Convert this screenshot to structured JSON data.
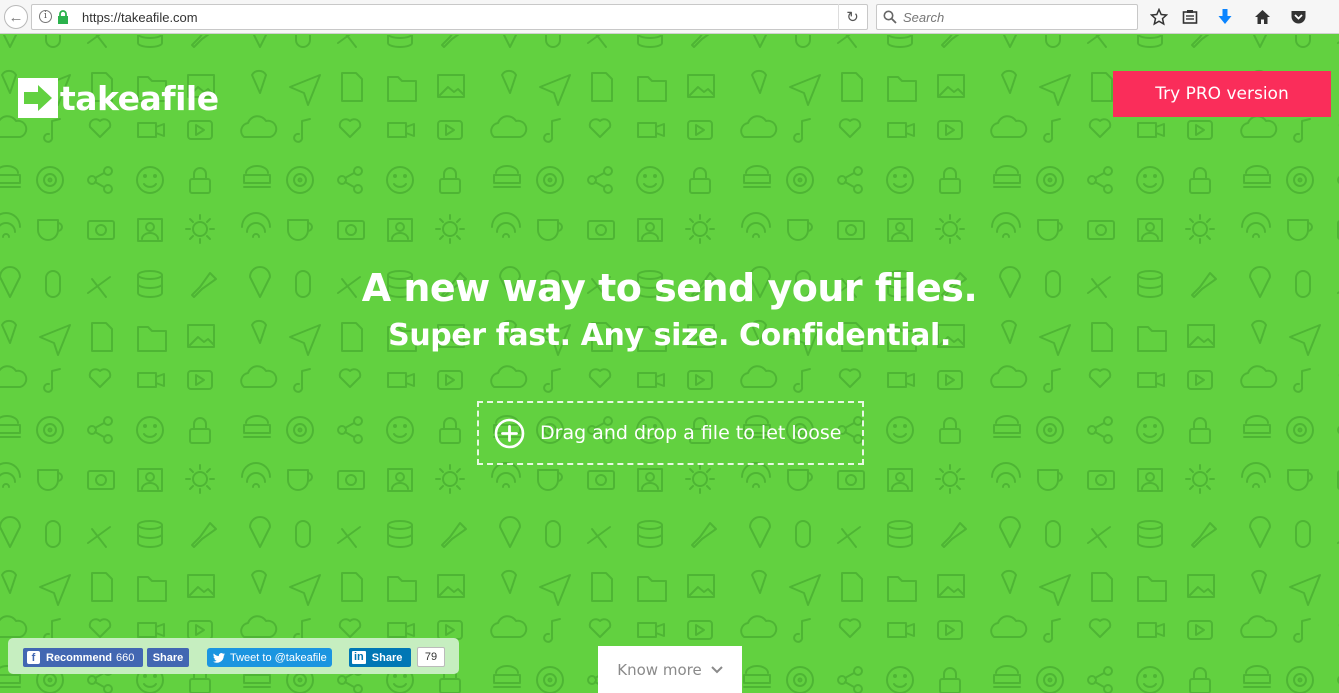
{
  "browser": {
    "url": "https://takeafile.com",
    "search_placeholder": "Search",
    "toolbar_icons": [
      "star-icon",
      "reading-list-icon",
      "download-icon",
      "home-icon",
      "pocket-icon"
    ]
  },
  "header": {
    "logo_text": "takeafile",
    "pro_button_label": "Try PRO version"
  },
  "hero": {
    "title": "A new way to send your files.",
    "subtitle": "Super fast. Any size. Confidential.",
    "drop_label": "Drag and drop a file to let loose"
  },
  "share": {
    "facebook_recommend_label": "Recommend",
    "facebook_count": "660",
    "facebook_share_label": "Share",
    "twitter_label": "Tweet to @takeafile",
    "linkedin_logo": "in",
    "linkedin_label": "Share",
    "linkedin_count": "79"
  },
  "know_more_label": "Know more",
  "colors": {
    "background": "#62d140",
    "pro_button": "#fa2d5a",
    "facebook": "#4267b2",
    "twitter": "#1b95e0",
    "linkedin": "#0077b5"
  }
}
